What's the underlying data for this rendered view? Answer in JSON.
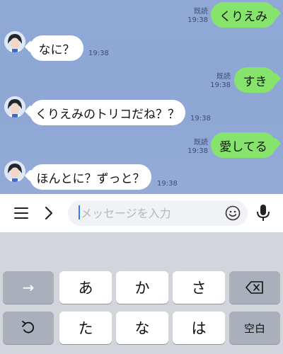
{
  "messages": [
    {
      "dir": "out",
      "text": "くりえみ",
      "read": "既読",
      "time": "19:38"
    },
    {
      "dir": "in",
      "text": "なに？",
      "time": "19:38"
    },
    {
      "dir": "out",
      "text": "すき",
      "read": "既読",
      "time": "19:38"
    },
    {
      "dir": "in",
      "text": "くりえみのトリコだね？？",
      "time": "19:38"
    },
    {
      "dir": "out",
      "text": "愛してる",
      "read": "既読",
      "time": "19:38"
    },
    {
      "dir": "in",
      "text": "ほんとに？ずっと？",
      "time": "19:38"
    }
  ],
  "input": {
    "placeholder": "メッセージを入力",
    "value": ""
  },
  "toolbar": {
    "menu_icon": "menu-icon",
    "expand_icon": "chevron-right-icon",
    "emoji_icon": "smile-icon",
    "mic_icon": "microphone-icon"
  },
  "keyboard": {
    "row1": [
      "→",
      "あ",
      "か",
      "さ",
      "⌫"
    ],
    "row2": [
      "undo",
      "た",
      "な",
      "は",
      "空白"
    ]
  },
  "colors": {
    "chat_bg": "#8fa8d6",
    "outgoing": "#86e36b",
    "incoming": "#ffffff",
    "caret": "#2f7cf6"
  }
}
